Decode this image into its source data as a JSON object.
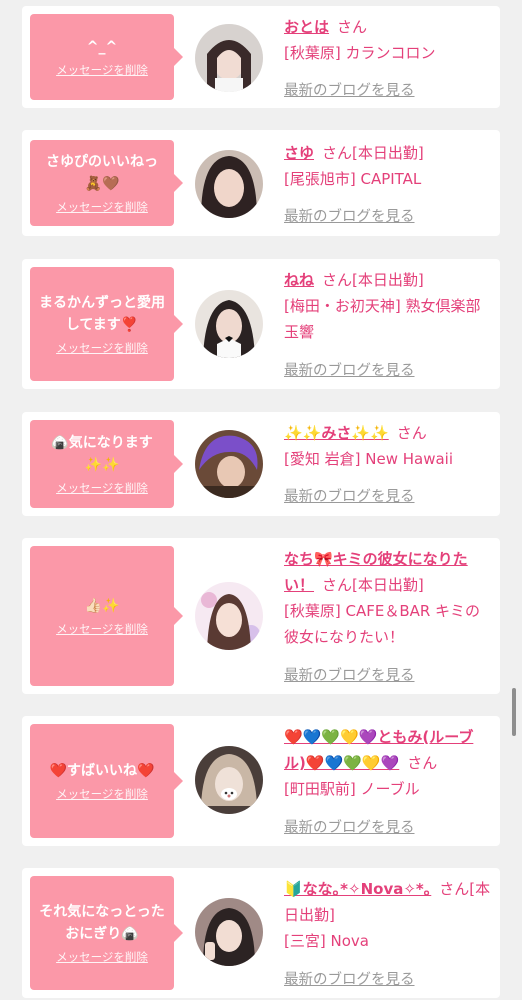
{
  "common": {
    "delete_label": "メッセージを削除",
    "blog_label": "最新のブログを見る",
    "honorific": "さん"
  },
  "items": [
    {
      "message": "^_^",
      "name": "おとは",
      "status": "",
      "shop": "[秋葉原] カランコロン"
    },
    {
      "message": "さゆぴのいいねっ\n🧸🤎",
      "name": "さゆ",
      "status": "[本日出勤]",
      "shop": "[尾張旭市] CAPITAL"
    },
    {
      "message": "まるかんずっと愛用してます❣️",
      "name": "ねね",
      "status": "[本日出勤]",
      "shop": "[梅田・お初天神] 熟女倶楽部 玉響"
    },
    {
      "message": "🍙気になります\n✨✨",
      "name": "✨✨みさ✨✨",
      "status": "",
      "shop": "[愛知 岩倉] New Hawaii"
    },
    {
      "message": "👍🏻✨",
      "name": "なち🎀キミの彼女になりたい！",
      "status": "[本日出勤]",
      "shop": "[秋葉原] CAFE＆BAR キミの彼女になりたい！"
    },
    {
      "message": "❤️すばいいね❤️",
      "name": "❤️💙💚💛💜ともみ(ルーブル)❤️💙💚💛💜",
      "status": "",
      "shop": "[町田駅前] ノーブル"
    },
    {
      "message": "それ気になっとったおにぎり🍙",
      "name": "🔰なな｡*✧Nova✧*｡",
      "status": "[本日出勤]",
      "shop": "[三宮] Nova"
    }
  ],
  "colors": {
    "accent": "#e4407a",
    "bubble": "#fb98a8",
    "background": "#f0f0f0",
    "link_gray": "#9a9a9a"
  }
}
